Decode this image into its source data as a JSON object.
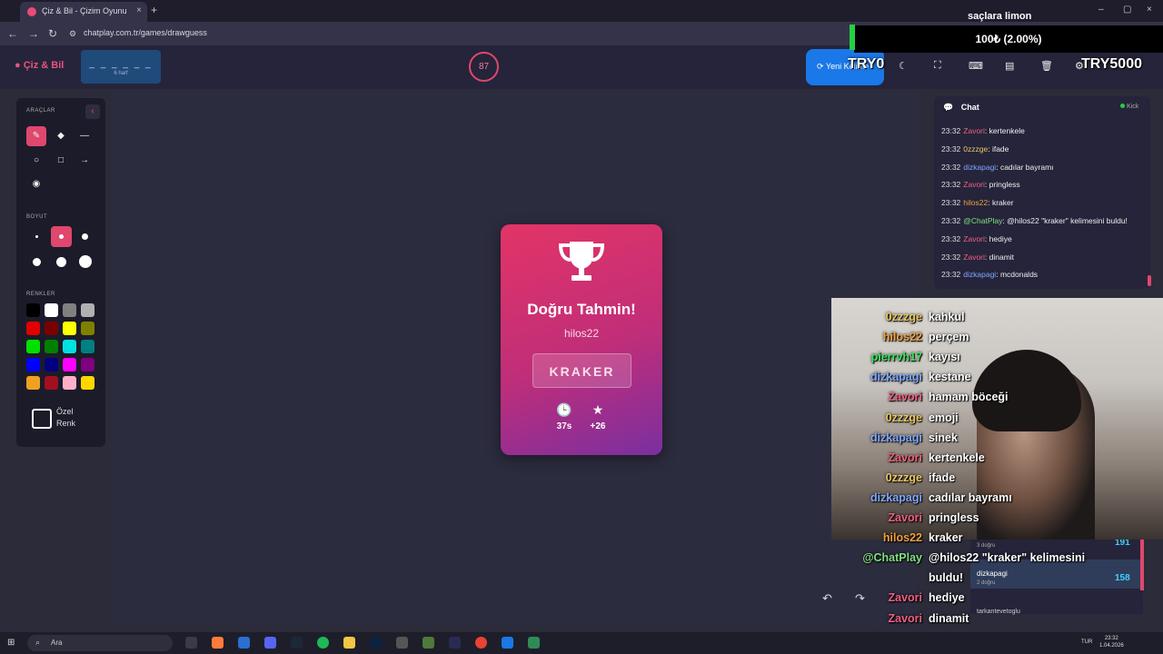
{
  "browser": {
    "tab_title": "Çiz & Bil - Çizim Oyunu",
    "url": "chatplay.com.tr/games/drawguess"
  },
  "app": {
    "logo": "Çiz & Bil",
    "word_blanks": "_ _ _ _ _ _",
    "word_hint": "6 harf",
    "timer": "87",
    "new_round_label": "Yeni Kelime"
  },
  "overlay": {
    "donor": "saçlara limon",
    "donation": "100₺ (2.00%)",
    "badge_left": "TRY0",
    "badge_right": "TRY5000"
  },
  "tools": {
    "section_tools": "ARAÇLAR",
    "section_size": "BOYUT",
    "section_colors": "RENKLER",
    "custom_color": "Özel Renk",
    "colors": [
      "#000000",
      "#ffffff",
      "#808080",
      "#b0b0b0",
      "#e00000",
      "#7a0000",
      "#ffff00",
      "#808000",
      "#00e000",
      "#008000",
      "#00e0e0",
      "#008080",
      "#0000ff",
      "#000080",
      "#ff00ff",
      "#800080",
      "#f0a020",
      "#a01020",
      "#ffb0c8",
      "#ffd700"
    ]
  },
  "card": {
    "title": "Doğru Tahmin!",
    "winner": "hilos22",
    "word": "KRAKER",
    "time": "37s",
    "points": "+26"
  },
  "chat": {
    "title": "Chat",
    "platform": "Kick",
    "messages": [
      {
        "time": "23:32",
        "user": "Zavori",
        "color": "#f06080",
        "text": "kertenkele"
      },
      {
        "time": "23:32",
        "user": "0zzzge",
        "color": "#e8c860",
        "text": "ifade"
      },
      {
        "time": "23:32",
        "user": "dizkapagi",
        "color": "#80a8ff",
        "text": "cadılar bayramı"
      },
      {
        "time": "23:32",
        "user": "Zavori",
        "color": "#f06080",
        "text": "pringless"
      },
      {
        "time": "23:32",
        "user": "hilos22",
        "color": "#f0a040",
        "text": "kraker"
      },
      {
        "time": "23:32",
        "user": "@ChatPlay",
        "color": "#80e080",
        "text": "@hilos22 \"kraker\" kelimesini buldu!"
      },
      {
        "time": "23:32",
        "user": "Zavori",
        "color": "#f06080",
        "text": "hediye"
      },
      {
        "time": "23:32",
        "user": "Zavori",
        "color": "#f06080",
        "text": "dinamit"
      },
      {
        "time": "23:32",
        "user": "dizkapagi",
        "color": "#80a8ff",
        "text": "mcdonalds"
      }
    ]
  },
  "overlay_chat": [
    {
      "user": "0zzzge",
      "color": "#e8c860",
      "text": "kahkul"
    },
    {
      "user": "hilos22",
      "color": "#f0a040",
      "text": "perçem"
    },
    {
      "user": "pierrvh17",
      "color": "#40e060",
      "text": "kayısı"
    },
    {
      "user": "dizkapagi",
      "color": "#80a8ff",
      "text": "kestane"
    },
    {
      "user": "Zavori",
      "color": "#f06080",
      "text": "hamam böceği"
    },
    {
      "user": "0zzzge",
      "color": "#e8c860",
      "text": "emoji"
    },
    {
      "user": "dizkapagi",
      "color": "#80a8ff",
      "text": "sinek"
    },
    {
      "user": "Zavori",
      "color": "#f06080",
      "text": "kertenkele"
    },
    {
      "user": "0zzzge",
      "color": "#e8c860",
      "text": "ifade"
    },
    {
      "user": "dizkapagi",
      "color": "#80a8ff",
      "text": "cadılar bayramı"
    },
    {
      "user": "Zavori",
      "color": "#f06080",
      "text": "pringless"
    },
    {
      "user": "hilos22",
      "color": "#f0a040",
      "text": "kraker"
    },
    {
      "user": "@ChatPlay",
      "color": "#80e080",
      "text": "@hilos22 \"kraker\" kelimesini"
    },
    {
      "user": "",
      "color": "#ffffff",
      "text": "buldu!"
    },
    {
      "user": "Zavori",
      "color": "#f06080",
      "text": "hediye"
    },
    {
      "user": "Zavori",
      "color": "#f06080",
      "text": "dinamit"
    },
    {
      "user": "dizkapagi",
      "color": "#80a8ff",
      "text": "mcdonalds"
    }
  ],
  "leaderboard": {
    "name": "dizkapagi",
    "sub": "2 doğru",
    "points": "158",
    "top_sub": "3 doğru",
    "top_points": "191",
    "next_name": "tarkantevetoglu"
  },
  "taskbar": {
    "search": "Ara",
    "lang": "TUR",
    "time": "23:32",
    "date": "1.04.2026"
  }
}
